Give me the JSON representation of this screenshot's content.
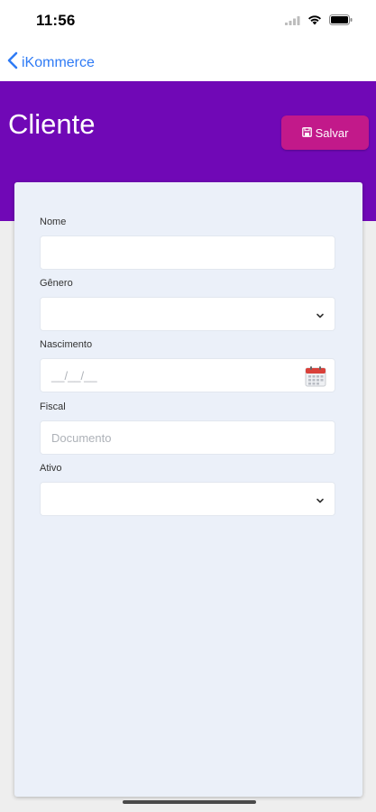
{
  "status_bar": {
    "time": "11:56"
  },
  "nav": {
    "back_label": "iKommerce"
  },
  "header": {
    "title": "Cliente",
    "save_label": "Salvar",
    "background_color": "#7008b6",
    "save_color": "#c2198a"
  },
  "form": {
    "nome": {
      "label": "Nome",
      "value": ""
    },
    "genero": {
      "label": "Gênero",
      "selected": ""
    },
    "nascimento": {
      "label": "Nascimento",
      "placeholder": "__/__/__"
    },
    "fiscal": {
      "label": "Fiscal",
      "placeholder": "Documento"
    },
    "ativo": {
      "label": "Ativo",
      "selected": ""
    }
  },
  "icons": {
    "back": "chevron-left-icon",
    "save": "save-icon",
    "select": "chevron-down-icon",
    "date": "calendar-icon"
  }
}
